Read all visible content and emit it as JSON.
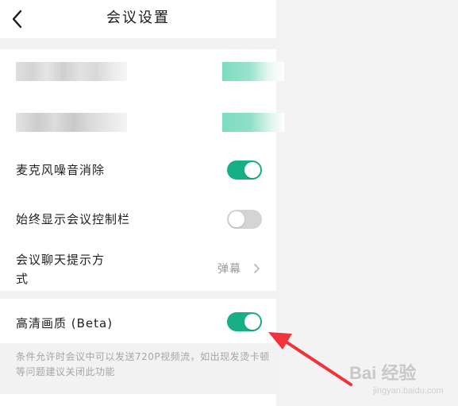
{
  "header": {
    "title": "会议设置"
  },
  "settings": {
    "noise_suppression": {
      "label": "麦克风噪音消除",
      "enabled": true
    },
    "always_show_controls": {
      "label": "始终显示会议控制栏",
      "enabled": false
    },
    "chat_hint": {
      "label_line1": "会议聊天提示方",
      "label_line2": "式",
      "value": "弹幕"
    },
    "hd_video": {
      "label": "高清画质 (Beta)",
      "enabled": true,
      "description": "条件允许时会议中可以发送720P视频流，如出现发烫卡顿等问题建议关闭此功能"
    }
  },
  "icons": {
    "back": "chevron-left-icon",
    "chevron": "chevron-right-icon"
  },
  "colors": {
    "accent": "#17b086",
    "toggle_off": "#d4d4d6",
    "arrow": "#f0323b"
  },
  "watermark": {
    "text": "Bai 经验",
    "sub": "jingyan.baidu.com"
  }
}
